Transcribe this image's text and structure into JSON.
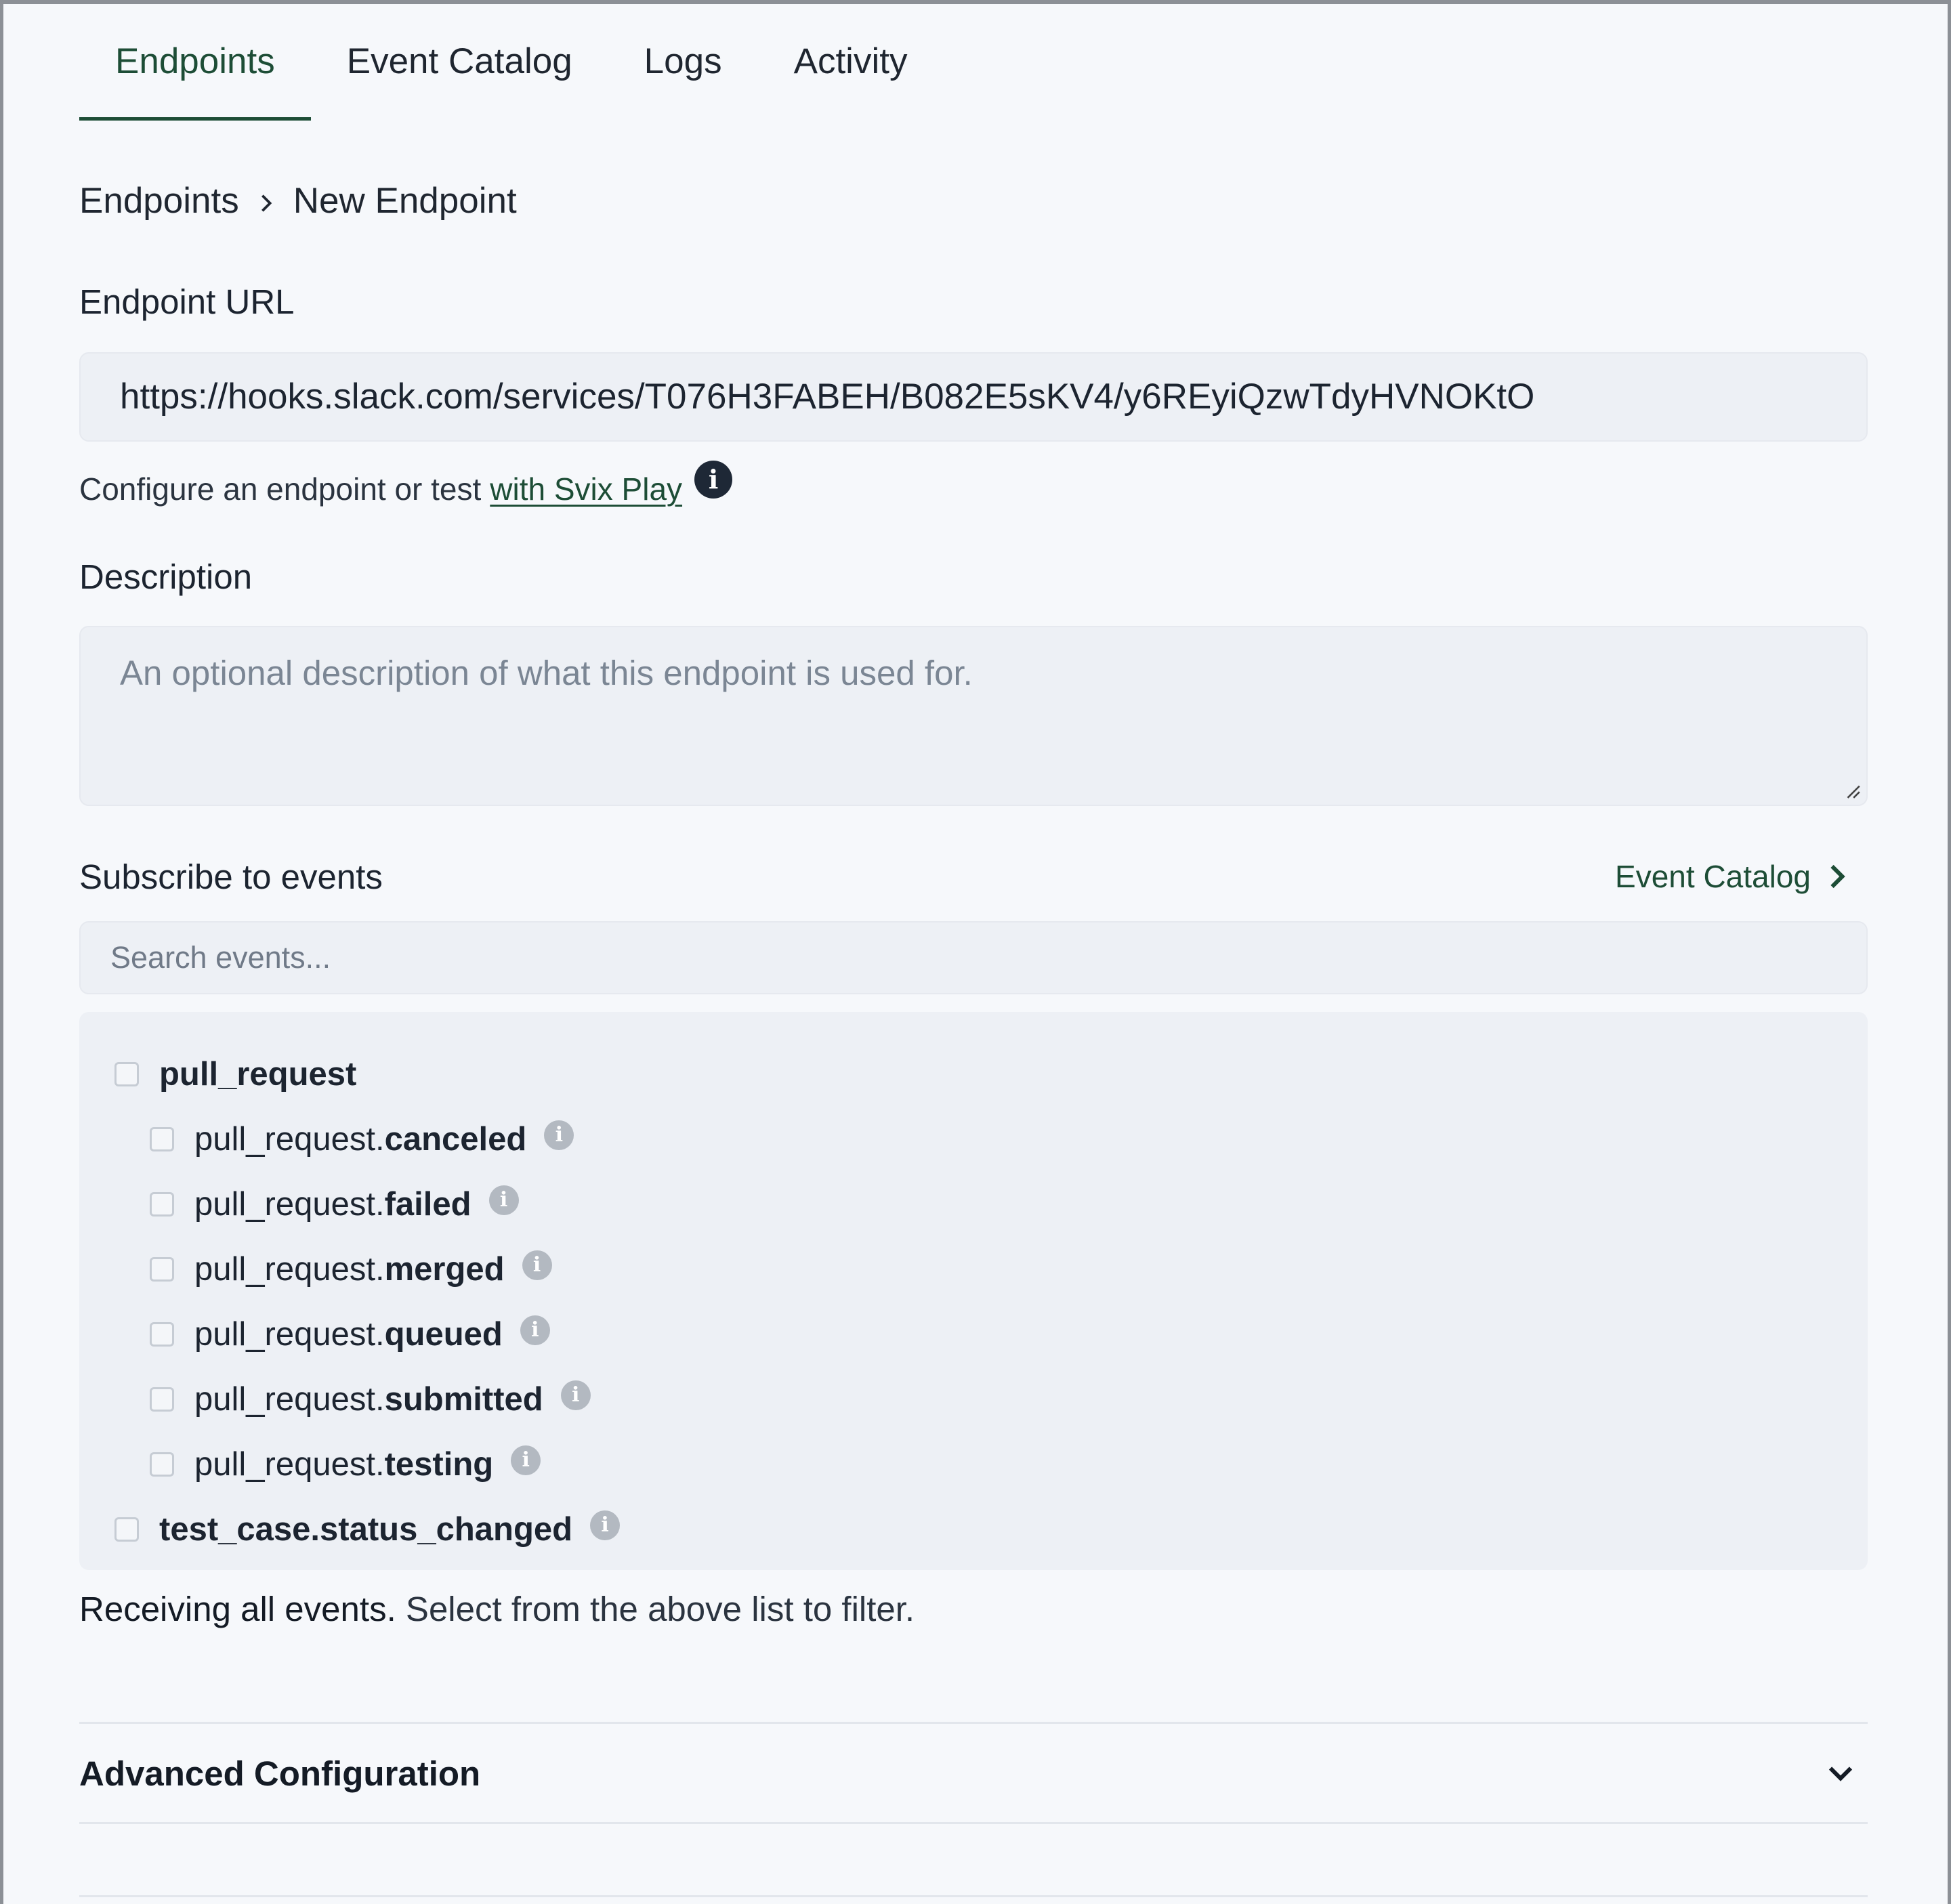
{
  "tabs": [
    {
      "label": "Endpoints",
      "active": true
    },
    {
      "label": "Event Catalog",
      "active": false
    },
    {
      "label": "Logs",
      "active": false
    },
    {
      "label": "Activity",
      "active": false
    }
  ],
  "breadcrumb": {
    "parent": "Endpoints",
    "current": "New Endpoint"
  },
  "endpoint_url": {
    "label": "Endpoint URL",
    "value": "https://hooks.slack.com/services/T076H3FABEH/B082E5sKV4/y6REyiQzwTdyHVNOKtO"
  },
  "helper": {
    "text": "Configure an endpoint or test",
    "link": "with Svix Play",
    "info_icon": "info-icon"
  },
  "description": {
    "label": "Description",
    "placeholder": "An optional description of what this endpoint is used for."
  },
  "subscribe": {
    "title": "Subscribe to events",
    "catalog_link": "Event Catalog",
    "search_placeholder": "Search events..."
  },
  "events": [
    {
      "prefix": "",
      "name": "pull_request",
      "level": 0,
      "info": false,
      "checked": false
    },
    {
      "prefix": "pull_request.",
      "name": "canceled",
      "level": 1,
      "info": true,
      "checked": false
    },
    {
      "prefix": "pull_request.",
      "name": "failed",
      "level": 1,
      "info": true,
      "checked": false
    },
    {
      "prefix": "pull_request.",
      "name": "merged",
      "level": 1,
      "info": true,
      "checked": false
    },
    {
      "prefix": "pull_request.",
      "name": "queued",
      "level": 1,
      "info": true,
      "checked": false
    },
    {
      "prefix": "pull_request.",
      "name": "submitted",
      "level": 1,
      "info": true,
      "checked": false
    },
    {
      "prefix": "pull_request.",
      "name": "testing",
      "level": 1,
      "info": true,
      "checked": false
    },
    {
      "prefix": "",
      "name": "test_case.status_changed",
      "level": 0,
      "info": true,
      "checked": false
    }
  ],
  "receiving": {
    "strong": "Receiving all events.",
    "rest": "Select from the above list to filter."
  },
  "advanced": {
    "title": "Advanced Configuration"
  },
  "colors": {
    "accent": "#1d4d36",
    "background": "#f6f8fb",
    "input_bg": "#edf0f5"
  }
}
